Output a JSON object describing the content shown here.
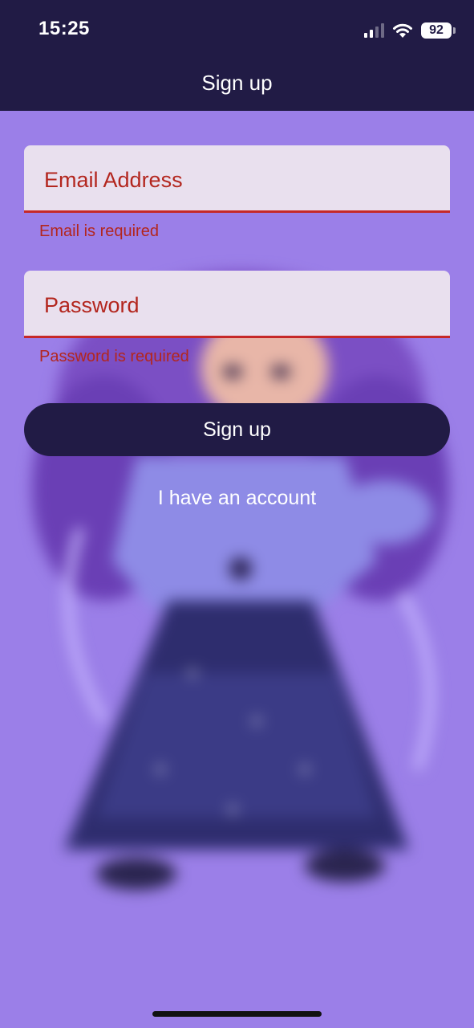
{
  "status_bar": {
    "time": "15:25",
    "battery_level": "92",
    "icons": [
      "cellular-signal-icon",
      "wifi-icon",
      "battery-icon"
    ]
  },
  "header": {
    "title": "Sign up"
  },
  "form": {
    "email": {
      "label": "Email Address",
      "value": "",
      "error": "Email is required"
    },
    "password": {
      "label": "Password",
      "value": "",
      "error": "Password is required"
    },
    "submit_label": "Sign up",
    "account_link_label": "I have an account"
  },
  "colors": {
    "header_bg": "#211b45",
    "page_bg": "#9b7fe8",
    "field_bg": "#e9e0ee",
    "error": "#b3261e",
    "button_bg": "#211b45"
  }
}
